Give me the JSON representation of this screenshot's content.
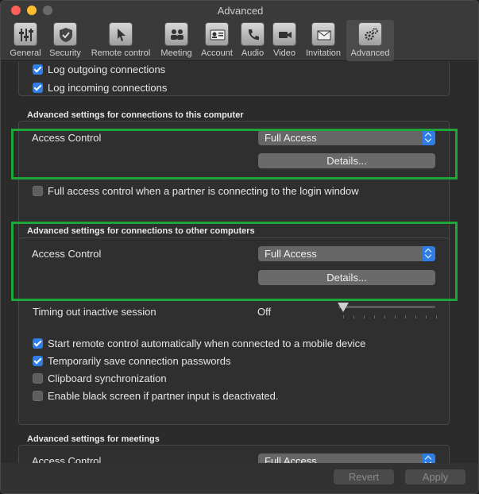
{
  "window": {
    "title": "Advanced"
  },
  "toolbar": {
    "items": [
      {
        "label": "General",
        "icon": "sliders-icon"
      },
      {
        "label": "Security",
        "icon": "shield-icon"
      },
      {
        "label": "Remote control",
        "icon": "cursor-icon"
      },
      {
        "label": "Meeting",
        "icon": "people-icon"
      },
      {
        "label": "Account",
        "icon": "id-card-icon"
      },
      {
        "label": "Audio",
        "icon": "phone-icon"
      },
      {
        "label": "Video",
        "icon": "camera-icon"
      },
      {
        "label": "Invitation",
        "icon": "envelope-icon"
      },
      {
        "label": "Advanced",
        "icon": "gears-icon"
      }
    ]
  },
  "top_section": {
    "log_outgoing": "Log outgoing connections",
    "log_incoming": "Log incoming connections"
  },
  "this_computer": {
    "title": "Advanced settings for connections to this computer",
    "access_label": "Access Control",
    "access_value": "Full Access",
    "details": "Details...",
    "login_window": "Full access control when a partner is connecting to the login window"
  },
  "other_computers": {
    "title": "Advanced settings for connections to other computers",
    "access_label": "Access Control",
    "access_value": "Full Access",
    "details": "Details...",
    "timeout_label": "Timing out inactive session",
    "timeout_value": "Off",
    "opt_start_remote": "Start remote control automatically when connected to a mobile device",
    "opt_save_passwords": "Temporarily save connection passwords",
    "opt_clipboard": "Clipboard synchronization",
    "opt_black_screen": "Enable black screen if partner input is deactivated."
  },
  "meetings": {
    "title": "Advanced settings for meetings",
    "access_label": "Access Control",
    "access_value": "Full Access"
  },
  "footer": {
    "revert": "Revert",
    "apply": "Apply"
  },
  "colors": {
    "highlight": "#1fa638",
    "accent": "#2f7ee8"
  }
}
